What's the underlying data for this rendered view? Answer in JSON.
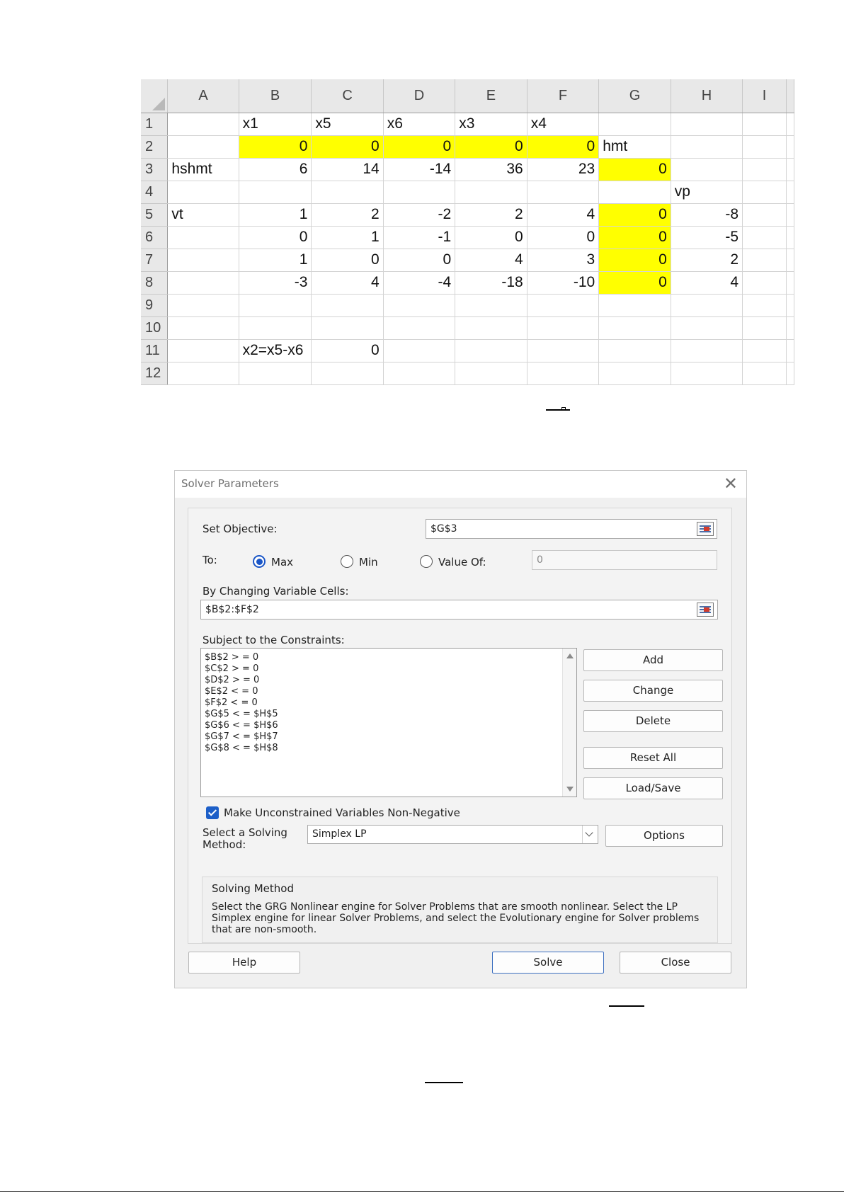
{
  "sheet": {
    "columns": [
      "A",
      "B",
      "C",
      "D",
      "E",
      "F",
      "G",
      "H",
      "I"
    ],
    "rows": [
      {
        "n": "1",
        "c": [
          "",
          "x1",
          "x5",
          "x6",
          "x3",
          "x4",
          "",
          "",
          ""
        ]
      },
      {
        "n": "2",
        "c": [
          "",
          "0",
          "0",
          "0",
          "0",
          "0",
          "hmt",
          "",
          ""
        ]
      },
      {
        "n": "3",
        "c": [
          "hshmt",
          "6",
          "14",
          "-14",
          "36",
          "23",
          "0",
          "",
          ""
        ]
      },
      {
        "n": "4",
        "c": [
          "",
          "",
          "",
          "",
          "",
          "",
          "",
          "vp",
          ""
        ]
      },
      {
        "n": "5",
        "c": [
          "vt",
          "1",
          "2",
          "-2",
          "2",
          "4",
          "0",
          "-8",
          ""
        ]
      },
      {
        "n": "6",
        "c": [
          "",
          "0",
          "1",
          "-1",
          "0",
          "0",
          "0",
          "-5",
          ""
        ]
      },
      {
        "n": "7",
        "c": [
          "",
          "1",
          "0",
          "0",
          "4",
          "3",
          "0",
          "2",
          ""
        ]
      },
      {
        "n": "8",
        "c": [
          "",
          "-3",
          "4",
          "-4",
          "-18",
          "-10",
          "0",
          "4",
          ""
        ]
      },
      {
        "n": "9",
        "c": [
          "",
          "",
          "",
          "",
          "",
          "",
          "",
          "",
          ""
        ]
      },
      {
        "n": "10",
        "c": [
          "",
          "",
          "",
          "",
          "",
          "",
          "",
          "",
          ""
        ]
      },
      {
        "n": "11",
        "c": [
          "",
          "x2=x5-x6",
          "0",
          "",
          "",
          "",
          "",
          "",
          ""
        ]
      },
      {
        "n": "12",
        "c": [
          "",
          "",
          "",
          "",
          "",
          "",
          "",
          "",
          ""
        ]
      }
    ],
    "highlight_color": "#ffff00"
  },
  "dialog": {
    "title": "Solver Parameters",
    "close_glyph": "✕",
    "set_objective_label": "Set Objective:",
    "objective_value": "$G$3",
    "to_label": "To:",
    "max_label": "Max",
    "min_label": "Min",
    "value_of_label": "Value Of:",
    "value_of_value": "0",
    "selected_goal": "Max",
    "changing_label": "By Changing Variable Cells:",
    "changing_value": "$B$2:$F$2",
    "constraints_label": "Subject to the Constraints:",
    "constraints": [
      "$B$2 > = 0",
      "$C$2 > = 0",
      "$D$2 > = 0",
      "$E$2 < = 0",
      "$F$2 < = 0",
      "$G$5 < = $H$5",
      "$G$6 < = $H$6",
      "$G$7 < = $H$7",
      "$G$8 < = $H$8"
    ],
    "buttons": {
      "add": "Add",
      "change": "Change",
      "delete": "Delete",
      "reset_all": "Reset All",
      "load_save": "Load/Save",
      "options": "Options",
      "help": "Help",
      "solve": "Solve",
      "close": "Close"
    },
    "nonneg_label": "Make Unconstrained Variables Non-Negative",
    "nonneg_checked": true,
    "method_label_line1": "Select a Solving",
    "method_label_line2": "Method:",
    "method_value": "Simplex LP",
    "solving_method_title": "Solving Method",
    "solving_method_text": "Select the GRG Nonlinear engine for Solver Problems that are smooth nonlinear. Select the LP Simplex engine for linear Solver Problems, and select the Evolutionary engine for Solver problems that are non-smooth.",
    "accent_color": "#1a56c7"
  }
}
